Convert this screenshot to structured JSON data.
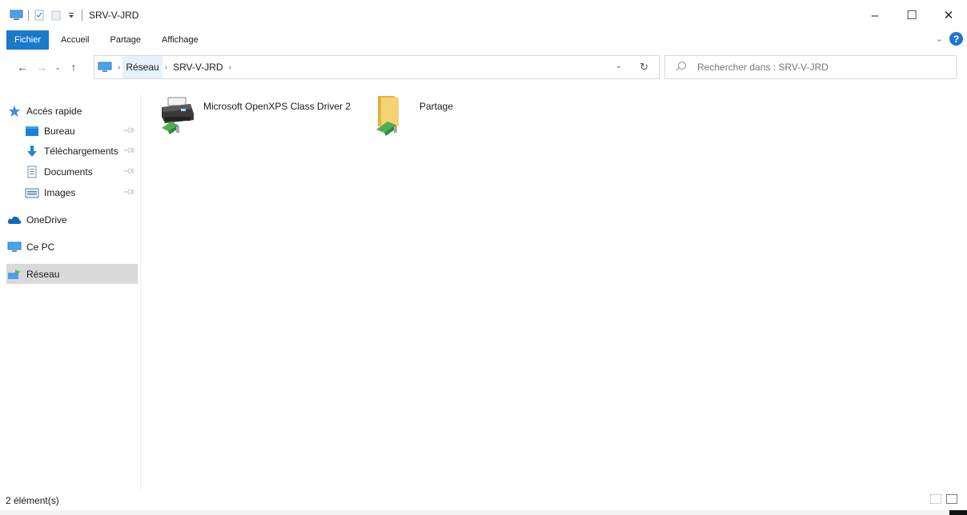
{
  "window": {
    "title": "SRV-V-JRD",
    "controls": {
      "minimize": "–",
      "maximize": "☐",
      "close": "✕"
    }
  },
  "ribbon": {
    "tabs": [
      "Fichier",
      "Accueil",
      "Partage",
      "Affichage"
    ],
    "help_label": "?",
    "accent_color": "#1979ca"
  },
  "navigation": {
    "back": "←",
    "forward": "→",
    "recent": "⌄",
    "up": "↑",
    "breadcrumb": [
      "Réseau",
      "SRV-V-JRD"
    ],
    "search_placeholder": "Rechercher dans : SRV-V-JRD"
  },
  "sidebar": {
    "items": [
      {
        "label": "Accès rapide",
        "icon": "star-icon",
        "pinned": false
      },
      {
        "label": "Bureau",
        "icon": "desktop-icon",
        "pinned": true
      },
      {
        "label": "Téléchargements",
        "icon": "download-icon",
        "pinned": true
      },
      {
        "label": "Documents",
        "icon": "document-icon",
        "pinned": true
      },
      {
        "label": "Images",
        "icon": "images-icon",
        "pinned": true
      },
      {
        "label": "OneDrive",
        "icon": "cloud-icon",
        "pinned": false
      },
      {
        "label": "Ce PC",
        "icon": "computer-icon",
        "pinned": false
      },
      {
        "label": "Réseau",
        "icon": "network-icon",
        "pinned": false,
        "selected": true
      }
    ]
  },
  "content": {
    "items": [
      {
        "label": "Microsoft OpenXPS Class Driver 2",
        "icon": "shared-printer-icon"
      },
      {
        "label": "Partage",
        "icon": "shared-folder-icon"
      }
    ]
  },
  "statusbar": {
    "count": "2 élément(s)"
  }
}
